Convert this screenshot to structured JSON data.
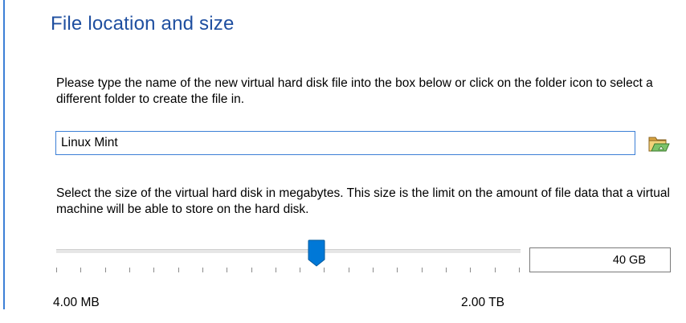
{
  "section": {
    "title": "File location and size"
  },
  "location": {
    "instructions": "Please type the name of the new virtual hard disk file into the box below or click on the folder icon to select a different folder to create the file in.",
    "file_name_value": "Linux Mint",
    "folder_icon": "folder-open-icon"
  },
  "size": {
    "instructions": "Select the size of the virtual hard disk in megabytes. This size is the limit on the amount of file data that a virtual machine will be able to store on the hard disk.",
    "value": "40 GB",
    "slider_position_fraction": 0.56,
    "min_label": "4.00 MB",
    "max_label": "2.00 TB"
  },
  "colors": {
    "title": "#1f4fa0",
    "accent": "#0078d7",
    "input_border": "#3c7fd6"
  }
}
